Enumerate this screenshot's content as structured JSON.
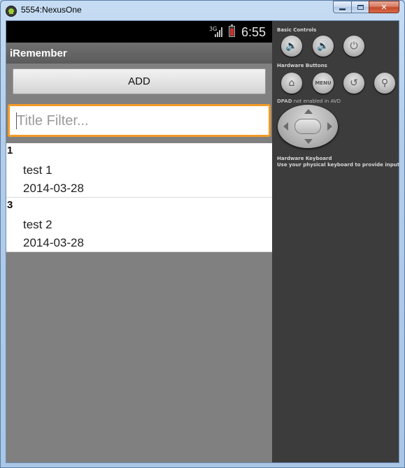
{
  "window": {
    "title": "5554:NexusOne"
  },
  "statusbar": {
    "network": "3G",
    "time": "6:55"
  },
  "app": {
    "title": "iRemember",
    "add_label": "ADD",
    "filter_placeholder": "Title Filter..."
  },
  "items": [
    {
      "id": "1",
      "title": "test 1",
      "date": "2014-03-28"
    },
    {
      "id": "3",
      "title": "test 2",
      "date": "2014-03-28"
    }
  ],
  "panel": {
    "basic_controls_label": "Basic Controls",
    "hardware_buttons_label": "Hardware Buttons",
    "dpad_bold": "DPAD",
    "dpad_note": "not enabled in AVD",
    "keyboard_label": "Hardware Keyboard",
    "keyboard_note": "Use your physical keyboard to provide input",
    "menu_label": "MENU"
  },
  "colors": {
    "accent": "#f39b27",
    "screen_bg": "#808080",
    "panel_bg": "#3c3c3c"
  }
}
